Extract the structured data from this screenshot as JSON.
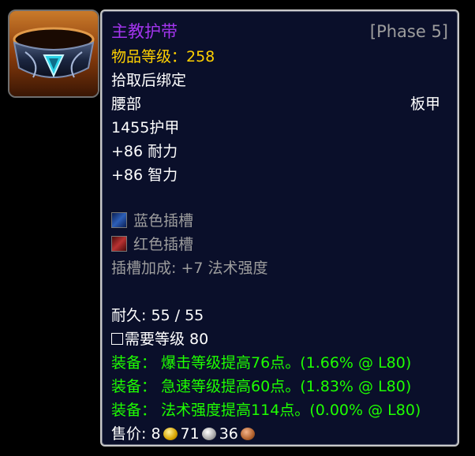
{
  "item": {
    "name": "主教护带",
    "phase": "[Phase 5]",
    "item_level": "物品等级：258",
    "binding": "拾取后绑定",
    "slot": "腰部",
    "armor_type": "板甲",
    "armor": "1455护甲",
    "stats": [
      "+86 耐力",
      "+86 智力"
    ],
    "sockets": [
      {
        "color": "blue",
        "label": "蓝色插槽"
      },
      {
        "color": "red",
        "label": "红色插槽"
      }
    ],
    "socket_bonus": "插槽加成: +7 法术强度",
    "durability": "耐久: 55 / 55",
    "required_level": "需要等级 80",
    "equip_effects": [
      "装备： 爆击等级提高76点。(1.66% @ L80)",
      "装备： 急速等级提高60点。(1.83% @ L80)",
      "装备： 法术强度提高114点。(0.00% @ L80)"
    ],
    "sell_price": {
      "label": "售价: 8",
      "silver": "71",
      "copper": "36"
    }
  },
  "colors": {
    "epic": "#a335ee",
    "item_level": "#ffd100",
    "gray": "#9d9d9d",
    "green": "#1eff00",
    "background": "#0a0f2a"
  },
  "icons": {
    "item": "belt-icon",
    "gold": "gold-coin-icon",
    "silver": "silver-coin-icon",
    "copper": "copper-coin-icon"
  }
}
